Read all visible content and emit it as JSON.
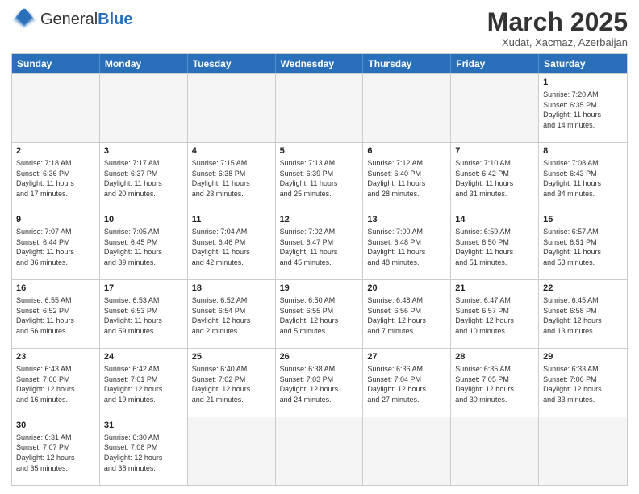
{
  "header": {
    "logo_general": "General",
    "logo_blue": "Blue",
    "month_title": "March 2025",
    "subtitle": "Xudat, Xacmaz, Azerbaijan"
  },
  "days_of_week": [
    "Sunday",
    "Monday",
    "Tuesday",
    "Wednesday",
    "Thursday",
    "Friday",
    "Saturday"
  ],
  "rows": [
    [
      {
        "day": "",
        "info": ""
      },
      {
        "day": "",
        "info": ""
      },
      {
        "day": "",
        "info": ""
      },
      {
        "day": "",
        "info": ""
      },
      {
        "day": "",
        "info": ""
      },
      {
        "day": "",
        "info": ""
      },
      {
        "day": "1",
        "info": "Sunrise: 7:20 AM\nSunset: 6:35 PM\nDaylight: 11 hours\nand 14 minutes."
      }
    ],
    [
      {
        "day": "2",
        "info": "Sunrise: 7:18 AM\nSunset: 6:36 PM\nDaylight: 11 hours\nand 17 minutes."
      },
      {
        "day": "3",
        "info": "Sunrise: 7:17 AM\nSunset: 6:37 PM\nDaylight: 11 hours\nand 20 minutes."
      },
      {
        "day": "4",
        "info": "Sunrise: 7:15 AM\nSunset: 6:38 PM\nDaylight: 11 hours\nand 23 minutes."
      },
      {
        "day": "5",
        "info": "Sunrise: 7:13 AM\nSunset: 6:39 PM\nDaylight: 11 hours\nand 25 minutes."
      },
      {
        "day": "6",
        "info": "Sunrise: 7:12 AM\nSunset: 6:40 PM\nDaylight: 11 hours\nand 28 minutes."
      },
      {
        "day": "7",
        "info": "Sunrise: 7:10 AM\nSunset: 6:42 PM\nDaylight: 11 hours\nand 31 minutes."
      },
      {
        "day": "8",
        "info": "Sunrise: 7:08 AM\nSunset: 6:43 PM\nDaylight: 11 hours\nand 34 minutes."
      }
    ],
    [
      {
        "day": "9",
        "info": "Sunrise: 7:07 AM\nSunset: 6:44 PM\nDaylight: 11 hours\nand 36 minutes."
      },
      {
        "day": "10",
        "info": "Sunrise: 7:05 AM\nSunset: 6:45 PM\nDaylight: 11 hours\nand 39 minutes."
      },
      {
        "day": "11",
        "info": "Sunrise: 7:04 AM\nSunset: 6:46 PM\nDaylight: 11 hours\nand 42 minutes."
      },
      {
        "day": "12",
        "info": "Sunrise: 7:02 AM\nSunset: 6:47 PM\nDaylight: 11 hours\nand 45 minutes."
      },
      {
        "day": "13",
        "info": "Sunrise: 7:00 AM\nSunset: 6:48 PM\nDaylight: 11 hours\nand 48 minutes."
      },
      {
        "day": "14",
        "info": "Sunrise: 6:59 AM\nSunset: 6:50 PM\nDaylight: 11 hours\nand 51 minutes."
      },
      {
        "day": "15",
        "info": "Sunrise: 6:57 AM\nSunset: 6:51 PM\nDaylight: 11 hours\nand 53 minutes."
      }
    ],
    [
      {
        "day": "16",
        "info": "Sunrise: 6:55 AM\nSunset: 6:52 PM\nDaylight: 11 hours\nand 56 minutes."
      },
      {
        "day": "17",
        "info": "Sunrise: 6:53 AM\nSunset: 6:53 PM\nDaylight: 11 hours\nand 59 minutes."
      },
      {
        "day": "18",
        "info": "Sunrise: 6:52 AM\nSunset: 6:54 PM\nDaylight: 12 hours\nand 2 minutes."
      },
      {
        "day": "19",
        "info": "Sunrise: 6:50 AM\nSunset: 6:55 PM\nDaylight: 12 hours\nand 5 minutes."
      },
      {
        "day": "20",
        "info": "Sunrise: 6:48 AM\nSunset: 6:56 PM\nDaylight: 12 hours\nand 7 minutes."
      },
      {
        "day": "21",
        "info": "Sunrise: 6:47 AM\nSunset: 6:57 PM\nDaylight: 12 hours\nand 10 minutes."
      },
      {
        "day": "22",
        "info": "Sunrise: 6:45 AM\nSunset: 6:58 PM\nDaylight: 12 hours\nand 13 minutes."
      }
    ],
    [
      {
        "day": "23",
        "info": "Sunrise: 6:43 AM\nSunset: 7:00 PM\nDaylight: 12 hours\nand 16 minutes."
      },
      {
        "day": "24",
        "info": "Sunrise: 6:42 AM\nSunset: 7:01 PM\nDaylight: 12 hours\nand 19 minutes."
      },
      {
        "day": "25",
        "info": "Sunrise: 6:40 AM\nSunset: 7:02 PM\nDaylight: 12 hours\nand 21 minutes."
      },
      {
        "day": "26",
        "info": "Sunrise: 6:38 AM\nSunset: 7:03 PM\nDaylight: 12 hours\nand 24 minutes."
      },
      {
        "day": "27",
        "info": "Sunrise: 6:36 AM\nSunset: 7:04 PM\nDaylight: 12 hours\nand 27 minutes."
      },
      {
        "day": "28",
        "info": "Sunrise: 6:35 AM\nSunset: 7:05 PM\nDaylight: 12 hours\nand 30 minutes."
      },
      {
        "day": "29",
        "info": "Sunrise: 6:33 AM\nSunset: 7:06 PM\nDaylight: 12 hours\nand 33 minutes."
      }
    ],
    [
      {
        "day": "30",
        "info": "Sunrise: 6:31 AM\nSunset: 7:07 PM\nDaylight: 12 hours\nand 35 minutes."
      },
      {
        "day": "31",
        "info": "Sunrise: 6:30 AM\nSunset: 7:08 PM\nDaylight: 12 hours\nand 38 minutes."
      },
      {
        "day": "",
        "info": ""
      },
      {
        "day": "",
        "info": ""
      },
      {
        "day": "",
        "info": ""
      },
      {
        "day": "",
        "info": ""
      },
      {
        "day": "",
        "info": ""
      }
    ]
  ]
}
